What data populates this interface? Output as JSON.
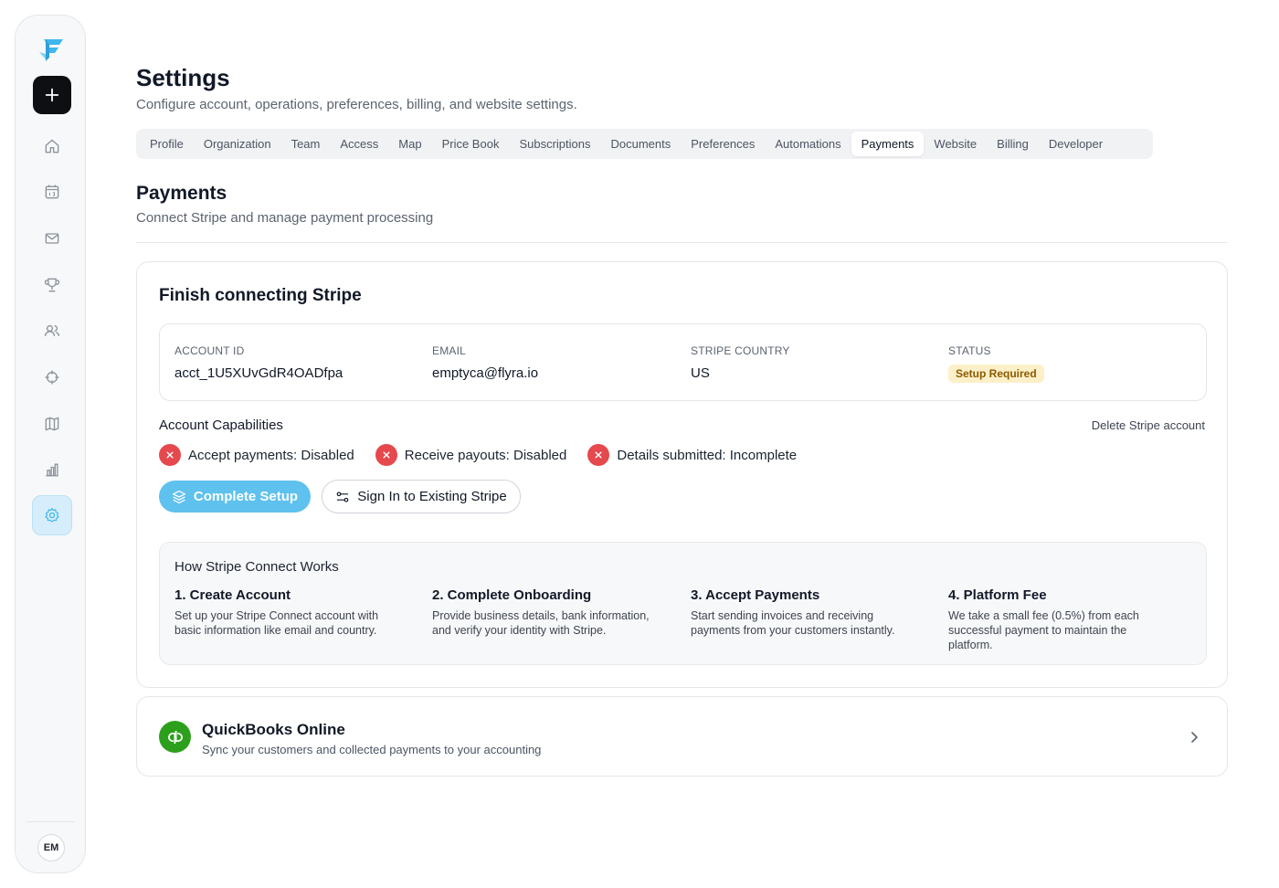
{
  "sidebar": {
    "logo_icon": "flyra-logo-icon",
    "new_icon": "plus-icon",
    "items": [
      {
        "icon": "home-icon"
      },
      {
        "icon": "calendar-icon"
      },
      {
        "icon": "mail-icon"
      },
      {
        "icon": "trophy-icon"
      },
      {
        "icon": "users-icon"
      },
      {
        "icon": "crosshair-icon"
      },
      {
        "icon": "map-icon"
      },
      {
        "icon": "bar-chart-icon"
      },
      {
        "icon": "settings-icon",
        "active": true
      }
    ],
    "avatar_initials": "EM"
  },
  "header": {
    "title": "Settings",
    "subtitle": "Configure account, operations, preferences, billing, and website settings."
  },
  "tabs": [
    {
      "label": "Profile"
    },
    {
      "label": "Organization"
    },
    {
      "label": "Team"
    },
    {
      "label": "Access"
    },
    {
      "label": "Map"
    },
    {
      "label": "Price Book"
    },
    {
      "label": "Subscriptions"
    },
    {
      "label": "Documents"
    },
    {
      "label": "Preferences"
    },
    {
      "label": "Automations"
    },
    {
      "label": "Payments",
      "active": true
    },
    {
      "label": "Website"
    },
    {
      "label": "Billing"
    },
    {
      "label": "Developer"
    }
  ],
  "section": {
    "title": "Payments",
    "subtitle": "Connect Stripe and manage payment processing"
  },
  "stripe": {
    "title": "Finish connecting Stripe",
    "account_id_label": "ACCOUNT ID",
    "account_id": "acct_1U5XUvGdR4OADfpa",
    "email_label": "EMAIL",
    "email": "emptyca@flyra.io",
    "country_label": "STRIPE COUNTRY",
    "country": "US",
    "status_label": "STATUS",
    "status": "Setup Required",
    "capabilities_title": "Account Capabilities",
    "delete_label": "Delete Stripe account",
    "capabilities": [
      {
        "text": "Accept payments: Disabled"
      },
      {
        "text": "Receive payouts: Disabled"
      },
      {
        "text": "Details submitted: Incomplete"
      }
    ],
    "complete_setup_label": "Complete Setup",
    "sign_in_label": "Sign In to Existing Stripe"
  },
  "how": {
    "title": "How Stripe Connect Works",
    "steps": [
      {
        "title": "1. Create Account",
        "desc": "Set up your Stripe Connect account with basic information like email and country."
      },
      {
        "title": "2. Complete Onboarding",
        "desc": "Provide business details, bank information, and verify your identity with Stripe."
      },
      {
        "title": "3. Accept Payments",
        "desc": "Start sending invoices and receiving payments from your customers instantly."
      },
      {
        "title": "4. Platform Fee",
        "desc": "We take a small fee (0.5%) from each successful payment to maintain the platform."
      }
    ]
  },
  "quickbooks": {
    "title": "QuickBooks Online",
    "description": "Sync your customers and collected payments to your accounting"
  },
  "colors": {
    "accent": "#5ec1ee",
    "error": "#e5484d",
    "warning_bg": "#fdf0c8",
    "quickbooks": "#2ca01c"
  }
}
